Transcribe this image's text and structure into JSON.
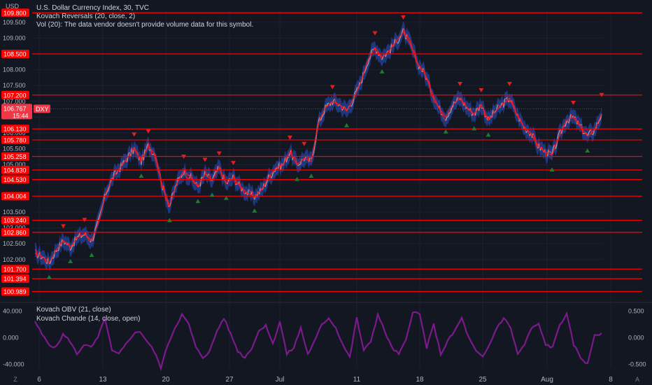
{
  "header": {
    "symbol_line": "U.S. Dollar Currency Index, 30, TVC",
    "indicator1": "Kovach Reversals (20, close, 2)",
    "indicator2": "Vol (20): The data vendor doesn't provide volume data for this symbol.",
    "currency": "USD"
  },
  "lower_pane": {
    "indicator1": "Kovach OBV (21, close)",
    "indicator2": "Kovach Chande (14, close, open)"
  },
  "footer": {
    "z_icon": "Z",
    "a_icon": "A"
  },
  "colors": {
    "background": "#131722",
    "level_line": "#ff0000",
    "label_bg": "#ff0000",
    "price_up": "#9a9ea8",
    "trend_down": "#ff1a1a",
    "trend_up": "#2952cc",
    "signal_down": "#e41e1e",
    "signal_up": "#1e7a2e",
    "oscillator": "#7b1a8c"
  },
  "chart_data": [
    {
      "type": "line",
      "title": "U.S. Dollar Currency Index, 30, TVC",
      "ylim": [
        100.8,
        109.85
      ],
      "left_axis_ticks": [
        "102.000",
        "102.500",
        "103.000",
        "103.500",
        "104.000",
        "104.500",
        "105.000",
        "105.500",
        "106.000",
        "106.500",
        "107.000",
        "107.500",
        "108.000",
        "108.500",
        "109.000",
        "109.500",
        "109.800"
      ],
      "horizontal_levels": [
        "109.800",
        "108.500",
        "107.200",
        "106.130",
        "105.780",
        "105.258",
        "104.830",
        "104.530",
        "104.004",
        "103.240",
        "102.860",
        "101.700",
        "101.394",
        "100.989"
      ],
      "current_price": "106.767",
      "current_symbol": "DXY",
      "countdown": "15:44",
      "x_ticks": [
        "6",
        "13",
        "20",
        "27",
        "Jul",
        "11",
        "18",
        "25",
        "Aug",
        "8"
      ],
      "series": [
        {
          "values": [
            102.2,
            102.1,
            101.9,
            102.3,
            102.6,
            102.4,
            102.7,
            102.8,
            102.6,
            103.2,
            104.1,
            104.6,
            104.9,
            105.2,
            105.5,
            105.1,
            105.6,
            105.3,
            104.3,
            103.7,
            104.4,
            104.8,
            104.6,
            104.3,
            104.7,
            104.5,
            104.9,
            104.4,
            104.6,
            104.3,
            104.1,
            104.0,
            104.2,
            104.6,
            104.9,
            105.0,
            105.4,
            105.0,
            105.2,
            105.1,
            106.3,
            106.8,
            107.0,
            106.9,
            106.7,
            107.1,
            107.6,
            108.3,
            108.7,
            108.4,
            108.6,
            108.9,
            109.2,
            108.8,
            108.2,
            107.9,
            107.3,
            106.8,
            106.5,
            106.9,
            107.1,
            106.8,
            106.6,
            106.9,
            106.4,
            106.7,
            106.9,
            107.1,
            106.6,
            106.2,
            106.0,
            105.6,
            105.4,
            105.3,
            105.9,
            106.4,
            106.5,
            106.2,
            105.9,
            106.1,
            106.6
          ]
        }
      ]
    },
    {
      "type": "line",
      "left_axis_ticks": [
        "40.000",
        "0.000",
        "-40.000"
      ],
      "right_axis_ticks": [
        "0.500",
        "0.000",
        "-0.500"
      ],
      "ylim": [
        -45,
        45
      ],
      "series": [
        {
          "name": "Kovach Chande (14, close, open)",
          "values": [
            25,
            5,
            -10,
            -15,
            5,
            -5,
            -25,
            -10,
            -15,
            0,
            30,
            -20,
            -25,
            -10,
            5,
            10,
            -5,
            -20,
            -45,
            -10,
            15,
            35,
            20,
            -15,
            -30,
            -20,
            10,
            30,
            5,
            -20,
            -30,
            -15,
            10,
            20,
            -10,
            25,
            -25,
            -15,
            15,
            -25,
            -5,
            20,
            30,
            15,
            -10,
            -30,
            30,
            -20,
            -5,
            35,
            10,
            -15,
            -25,
            -5,
            40,
            35,
            -15,
            20,
            -25,
            -5,
            10,
            30,
            0,
            -20,
            -30,
            -10,
            15,
            30,
            15,
            -25,
            -10,
            15,
            20,
            -10,
            -15,
            20,
            35,
            -10,
            -30,
            -40,
            5,
            5
          ]
        }
      ]
    }
  ]
}
